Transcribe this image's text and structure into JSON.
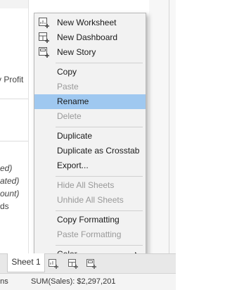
{
  "context_menu": {
    "items": [
      {
        "label": "New Worksheet",
        "icon": "new-worksheet-icon",
        "enabled": true
      },
      {
        "label": "New Dashboard",
        "icon": "new-dashboard-icon",
        "enabled": true
      },
      {
        "label": "New Story",
        "icon": "new-story-icon",
        "enabled": true
      },
      {
        "label": "Copy",
        "enabled": true
      },
      {
        "label": "Paste",
        "enabled": false
      },
      {
        "label": "Rename",
        "enabled": true,
        "highlighted": true
      },
      {
        "label": "Delete",
        "enabled": false
      },
      {
        "label": "Duplicate",
        "enabled": true
      },
      {
        "label": "Duplicate as Crosstab",
        "enabled": true
      },
      {
        "label": "Export...",
        "enabled": true
      },
      {
        "label": "Hide All Sheets",
        "enabled": false
      },
      {
        "label": "Unhide All Sheets",
        "enabled": false
      },
      {
        "label": "Copy Formatting",
        "enabled": true
      },
      {
        "label": "Paste Formatting",
        "enabled": false
      },
      {
        "label": "Color",
        "enabled": true,
        "submenu": true
      }
    ],
    "highlight_color": "#9fc8f0"
  },
  "background": {
    "left_panel_fragments": [
      "y Profit",
      "ed)",
      "ated)",
      "ount)",
      "ds"
    ]
  },
  "sheet_tabs": {
    "active_tab": "Sheet 1",
    "new_tab_icons": [
      "new-worksheet-tab-icon",
      "new-dashboard-tab-icon",
      "new-story-tab-icon"
    ]
  },
  "status_bar": {
    "left_fragment": "ons",
    "sum_text": "SUM(Sales): $2,297,201"
  }
}
